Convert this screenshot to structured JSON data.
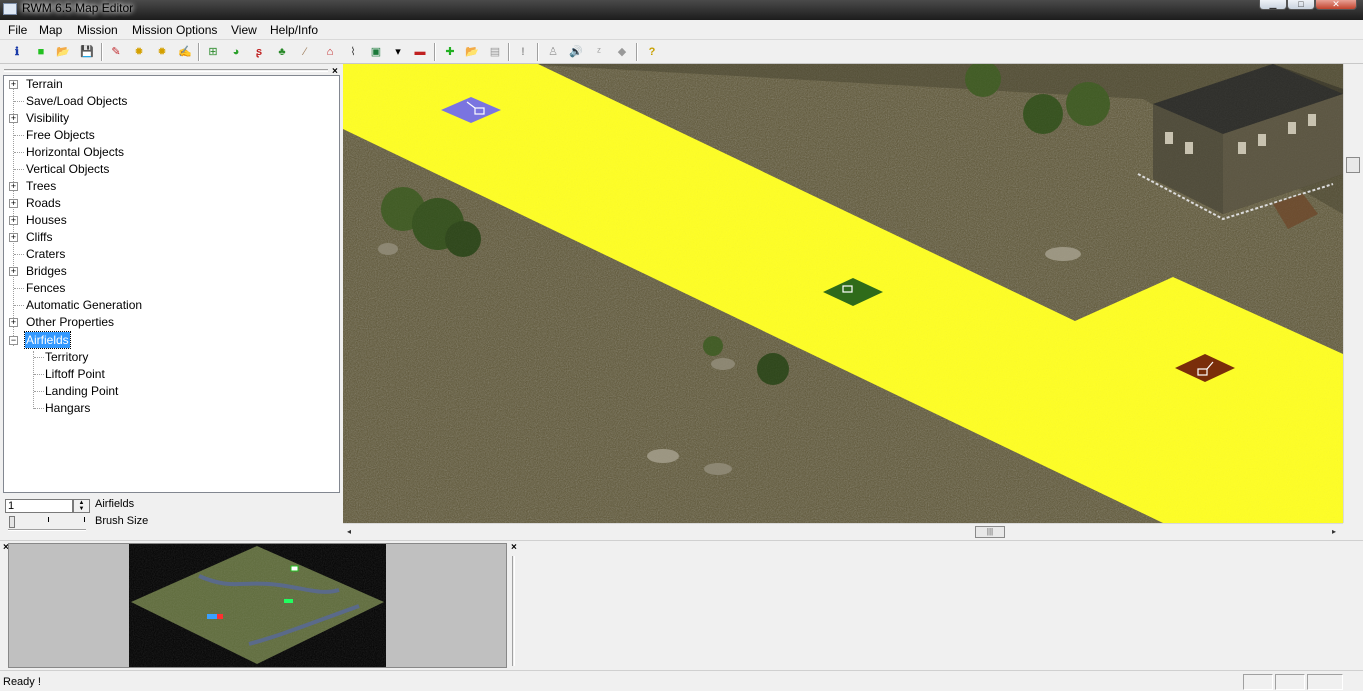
{
  "window": {
    "title": "RWM 6.5 Map Editor",
    "minimize": "▁",
    "maximize": "□",
    "close": "✕"
  },
  "menu": [
    "File",
    "Map",
    "Mission",
    "Mission Options",
    "View",
    "Help/Info"
  ],
  "toolbar": {
    "buttons": [
      "info-icon",
      "new-icon",
      "open-icon",
      "save-icon",
      "brush-icon",
      "gear-icon",
      "gear-alt-icon",
      "edit-icon",
      "align-icon",
      "terrain-icon",
      "sp-icon",
      "tree-icon",
      "pencil-icon",
      "house-icon",
      "bench-icon",
      "vehicle-icon",
      "dropdown-icon",
      "unit-icon",
      "add-icon",
      "folder-icon",
      "save-alt-icon",
      "alert-icon",
      "soldier-icon",
      "speaker-icon",
      "zz-icon",
      "arrow-icon",
      "help-icon"
    ],
    "glyphs": [
      "ℹ",
      "■",
      "📂",
      "💾",
      "✎",
      "✹",
      "✹",
      "✍",
      "⊞",
      "◕",
      "ʂ",
      "♣",
      "∕",
      "⌂",
      "⌇",
      "▣",
      "▾",
      "▬",
      "✚",
      "📂",
      "▤",
      "!",
      "♙",
      "🔊",
      "ᶻ",
      "◆",
      "?"
    ]
  },
  "tree": {
    "items": [
      {
        "label": "Terrain",
        "expander": "+",
        "level": 0
      },
      {
        "label": "Save/Load Objects",
        "expander": "",
        "level": 0
      },
      {
        "label": "Visibility",
        "expander": "+",
        "level": 0
      },
      {
        "label": "Free Objects",
        "expander": "",
        "level": 0
      },
      {
        "label": "Horizontal Objects",
        "expander": "",
        "level": 0
      },
      {
        "label": "Vertical Objects",
        "expander": "",
        "level": 0
      },
      {
        "label": "Trees",
        "expander": "+",
        "level": 0
      },
      {
        "label": "Roads",
        "expander": "+",
        "level": 0
      },
      {
        "label": "Houses",
        "expander": "+",
        "level": 0
      },
      {
        "label": "Cliffs",
        "expander": "+",
        "level": 0
      },
      {
        "label": "Craters",
        "expander": "",
        "level": 0
      },
      {
        "label": "Bridges",
        "expander": "+",
        "level": 0
      },
      {
        "label": "Fences",
        "expander": "",
        "level": 0
      },
      {
        "label": "Automatic Generation",
        "expander": "",
        "level": 0
      },
      {
        "label": "Other Properties",
        "expander": "+",
        "level": 0
      },
      {
        "label": "Airfields",
        "expander": "−",
        "level": 0,
        "selected": true
      },
      {
        "label": "Territory",
        "expander": "",
        "level": 1
      },
      {
        "label": "Liftoff Point",
        "expander": "",
        "level": 1
      },
      {
        "label": "Landing Point",
        "expander": "",
        "level": 1
      },
      {
        "label": "Hangars",
        "expander": "",
        "level": 1
      }
    ]
  },
  "controls": {
    "spin_value": "1",
    "spin_label": "Airfields",
    "brush_label": "Brush Size",
    "brush_level": 0.0
  },
  "close_glyph": "×",
  "scroll": {
    "hthumb": "|||",
    "left": "◂",
    "right": "▸"
  },
  "status": {
    "text": "Ready !"
  },
  "colors": {
    "airfield": "#ffff22",
    "marker_territory": "#7a74e0",
    "marker_liftoff": "#2f6b1a",
    "marker_landing": "#7a2e0a",
    "ground": "#5b5332",
    "selection": "#3399ff"
  }
}
